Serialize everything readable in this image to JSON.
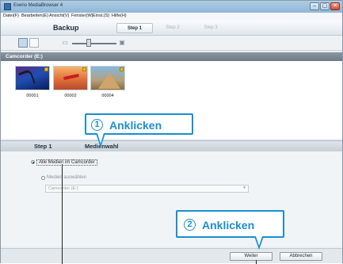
{
  "window": {
    "title": "Everio MediaBrowser 4",
    "controls": [
      "–",
      "▢",
      "✕"
    ]
  },
  "menu": [
    "Datei(F)",
    "Bearbeiten(E)",
    "Ansicht(V)",
    "Fenster(W)",
    "Einst.(S)",
    "Hilfe(H)"
  ],
  "header": {
    "title": "Backup",
    "steps": [
      {
        "label": "Step 1",
        "active": true
      },
      {
        "label": "Step 2",
        "active": false
      },
      {
        "label": "Step 3",
        "active": false
      }
    ]
  },
  "toolbar": {
    "view_buttons": [
      "thumbnail-view-icon",
      "list-view-icon"
    ],
    "zoom_icons": [
      "zoom-out-icon",
      "zoom-in-icon"
    ]
  },
  "device": {
    "label": "Camcorder (E:)"
  },
  "media": [
    {
      "label": "00001",
      "icon": "palm-beach-thumbnail"
    },
    {
      "label": "00002",
      "icon": "airplane-thumbnail"
    },
    {
      "label": "00004",
      "icon": "pyramid-thumbnail"
    }
  ],
  "step_bar": {
    "step": "Step 1",
    "name": "Medienwahl"
  },
  "options": {
    "all_media": "Alle Medien im Camcorder",
    "select_media": "Medien auswählen",
    "dropdown_value": "Camcorder (E:)"
  },
  "footer": {
    "next": "Weiter",
    "cancel": "Abbrechen"
  },
  "callouts": [
    {
      "number": "1",
      "text": "Anklicken"
    },
    {
      "number": "2",
      "text": "Anklicken"
    }
  ],
  "colors": {
    "callout_accent": "#1a8fd0",
    "device_bar": "#7a858f"
  }
}
